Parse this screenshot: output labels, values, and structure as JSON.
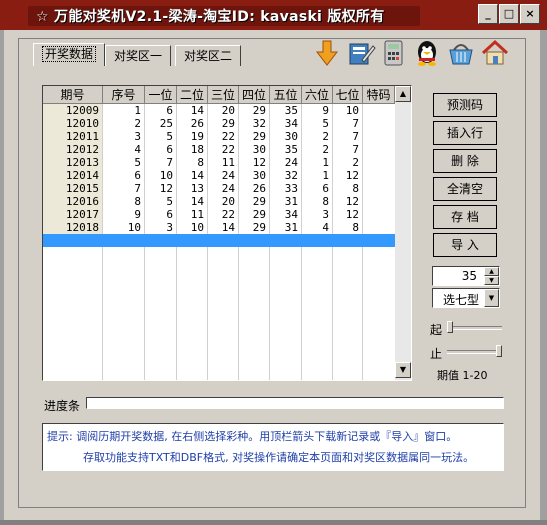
{
  "window": {
    "title": "☆ 万能对奖机V2.1-梁涛-淘宝ID: kavaski 版权所有",
    "min_label": "_",
    "max_label": "□",
    "close_label": "×"
  },
  "tabs": [
    {
      "label": "开奖数据",
      "active": true
    },
    {
      "label": "对奖区一",
      "active": false
    },
    {
      "label": "对奖区二",
      "active": false
    }
  ],
  "toolbar_icons": [
    "download-arrow-icon",
    "document-edit-icon",
    "calculator-icon",
    "qq-penguin-icon",
    "shopping-basket-icon",
    "home-icon"
  ],
  "table": {
    "headers": [
      "期号",
      "序号",
      "一位",
      "二位",
      "三位",
      "四位",
      "五位",
      "六位",
      "七位",
      "特码"
    ],
    "rows": [
      [
        "12009",
        "1",
        "6",
        "14",
        "20",
        "29",
        "35",
        "9",
        "10",
        ""
      ],
      [
        "12010",
        "2",
        "25",
        "26",
        "29",
        "32",
        "34",
        "5",
        "7",
        ""
      ],
      [
        "12011",
        "3",
        "5",
        "19",
        "22",
        "29",
        "30",
        "2",
        "7",
        ""
      ],
      [
        "12012",
        "4",
        "6",
        "18",
        "22",
        "30",
        "35",
        "2",
        "7",
        ""
      ],
      [
        "12013",
        "5",
        "7",
        "8",
        "11",
        "12",
        "24",
        "1",
        "2",
        ""
      ],
      [
        "12014",
        "6",
        "10",
        "14",
        "24",
        "30",
        "32",
        "1",
        "12",
        ""
      ],
      [
        "12015",
        "7",
        "12",
        "13",
        "24",
        "26",
        "33",
        "6",
        "8",
        ""
      ],
      [
        "12016",
        "8",
        "5",
        "14",
        "20",
        "29",
        "31",
        "8",
        "12",
        ""
      ],
      [
        "12017",
        "9",
        "6",
        "11",
        "22",
        "29",
        "34",
        "3",
        "12",
        ""
      ],
      [
        "12018",
        "10",
        "3",
        "10",
        "14",
        "29",
        "31",
        "4",
        "8",
        ""
      ]
    ]
  },
  "actions": {
    "predict": "预测码",
    "insert_row": "插入行",
    "delete": "删 除",
    "clear_all": "全清空",
    "save": "存 档",
    "import": "导 入"
  },
  "spinner": {
    "value": "35"
  },
  "mode_select": {
    "value": "选七型"
  },
  "range": {
    "start_label": "起",
    "end_label": "止",
    "start_level": 0.0,
    "end_level": 1.0,
    "text": "期值 1-20"
  },
  "progress": {
    "label": "进度条",
    "value": 0
  },
  "hint": {
    "line1": "提示: 调阅历期开奖数据, 在右侧选择彩种。用顶栏箭头下载新记录或『导入』窗口。",
    "line2": "存取功能支持TXT和DBF格式, 对奖操作请确定本页面和对奖区数据属同一玩法。"
  },
  "colors": {
    "title_bar": "#8a1d12",
    "selected_row": "#3399ff",
    "hint_text": "#1e3fa8",
    "face": "#d4d0c8"
  }
}
